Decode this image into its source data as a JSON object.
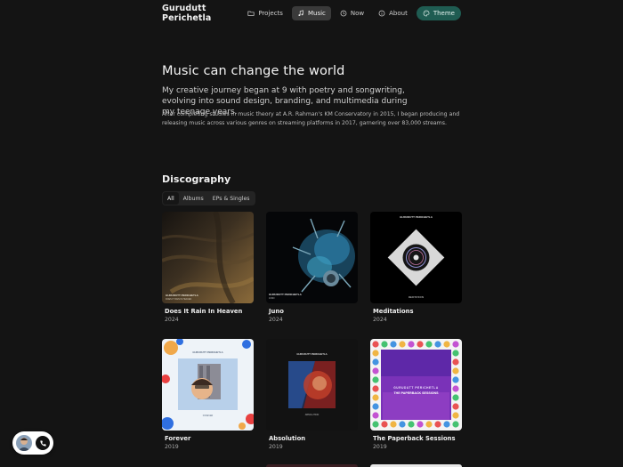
{
  "header": {
    "brand": "Gurudutt Perichetla",
    "nav": [
      {
        "label": "Projects",
        "icon": "folder-icon"
      },
      {
        "label": "Music",
        "icon": "music-note-icon"
      },
      {
        "label": "Now",
        "icon": "clock-icon"
      },
      {
        "label": "About",
        "icon": "info-icon"
      },
      {
        "label": "Theme",
        "icon": "palette-icon"
      }
    ],
    "active": "Music"
  },
  "hero": {
    "title": "Music can change the world",
    "lead": "My creative journey began at 9 with poetry and songwriting, evolving into sound design, branding, and multimedia during my teenage years.",
    "body": "After completing studies in music theory at A.R. Rahman's KM Conservatory in 2015, I began producing and releasing music across various genres on streaming platforms in 2017, garnering over 83,000 streams."
  },
  "discography": {
    "title": "Discography",
    "tabs": [
      "All",
      "Albums",
      "EPs & Singles"
    ],
    "active_tab": "All",
    "releases": [
      {
        "title": "Does It Rain In Heaven",
        "year": "2024",
        "cover_artist": "GURUDUTT PERICHETLA",
        "cover_subtitle": "DOES IT RAIN IN HEAVEN"
      },
      {
        "title": "Juno",
        "year": "2024",
        "cover_artist": "GURUDUTT PERICHETLA",
        "cover_subtitle": "JUNO"
      },
      {
        "title": "Meditations",
        "year": "2024",
        "cover_artist": "GURUDUTT PERICHETLA",
        "cover_subtitle": "MEDITATIONS"
      },
      {
        "title": "Forever",
        "year": "2019",
        "cover_artist": "GURUDUTT PERICHETLA",
        "cover_subtitle": "FOREVER"
      },
      {
        "title": "Absolution",
        "year": "2019",
        "cover_artist": "GURUDUTT PERICHETLA",
        "cover_subtitle": "ABSOLUTION"
      },
      {
        "title": "The Paperback Sessions",
        "year": "2019",
        "cover_artist": "GURUDUTT PERICHETLA",
        "cover_subtitle": "THE PAPERBACK SESSIONS"
      }
    ]
  },
  "widget": {
    "avatar_icon": "avatar-icon",
    "call_icon": "phone-icon"
  },
  "colors": {
    "background": "#141414",
    "theme_button": "#1f5c52",
    "active_nav": "#3a3a3a"
  }
}
